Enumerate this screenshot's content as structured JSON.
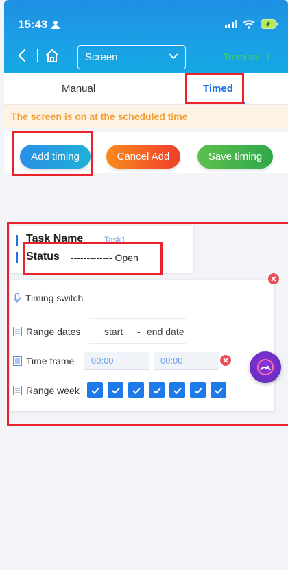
{
  "status_bar": {
    "time": "15:43"
  },
  "nav": {
    "select_value": "Screen",
    "terminal_text": "Terminal: 1"
  },
  "tabs": {
    "manual": "Manual",
    "timed": "Timed"
  },
  "notice": "The screen is on at the scheduled time",
  "buttons": {
    "add": "Add timing",
    "cancel": "Cancel Add",
    "save": "Save timing"
  },
  "task": {
    "name_label": "Task Name",
    "name_value": "Task1",
    "status_label": "Status",
    "status_value": "------------- Open"
  },
  "timing": {
    "switch_label": "Timing switch",
    "range_dates_label": "Range dates",
    "start_placeholder": "start",
    "date_sep": "-",
    "end_placeholder": "end date",
    "time_frame_label": "Time frame",
    "time_start": "00:00",
    "time_end": "00:00",
    "range_week_label": "Range week",
    "week_days_checked": [
      true,
      true,
      true,
      true,
      true,
      true,
      true
    ]
  },
  "colors": {
    "accent": "#1a73e8",
    "header_blue": "#1ba0e6",
    "notice_text": "#f0a23a",
    "highlight_red": "#e8232b",
    "terminal_green": "#3fcf66"
  }
}
